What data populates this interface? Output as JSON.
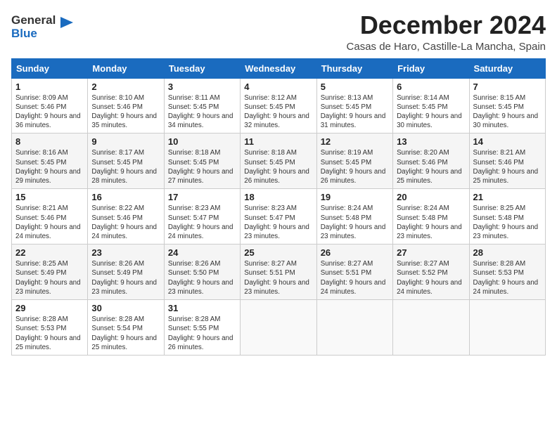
{
  "logo": {
    "general": "General",
    "blue": "Blue"
  },
  "title": "December 2024",
  "subtitle": "Casas de Haro, Castille-La Mancha, Spain",
  "headers": [
    "Sunday",
    "Monday",
    "Tuesday",
    "Wednesday",
    "Thursday",
    "Friday",
    "Saturday"
  ],
  "weeks": [
    [
      {
        "day": "1",
        "sunrise": "Sunrise: 8:09 AM",
        "sunset": "Sunset: 5:46 PM",
        "daylight": "Daylight: 9 hours and 36 minutes."
      },
      {
        "day": "2",
        "sunrise": "Sunrise: 8:10 AM",
        "sunset": "Sunset: 5:46 PM",
        "daylight": "Daylight: 9 hours and 35 minutes."
      },
      {
        "day": "3",
        "sunrise": "Sunrise: 8:11 AM",
        "sunset": "Sunset: 5:45 PM",
        "daylight": "Daylight: 9 hours and 34 minutes."
      },
      {
        "day": "4",
        "sunrise": "Sunrise: 8:12 AM",
        "sunset": "Sunset: 5:45 PM",
        "daylight": "Daylight: 9 hours and 32 minutes."
      },
      {
        "day": "5",
        "sunrise": "Sunrise: 8:13 AM",
        "sunset": "Sunset: 5:45 PM",
        "daylight": "Daylight: 9 hours and 31 minutes."
      },
      {
        "day": "6",
        "sunrise": "Sunrise: 8:14 AM",
        "sunset": "Sunset: 5:45 PM",
        "daylight": "Daylight: 9 hours and 30 minutes."
      },
      {
        "day": "7",
        "sunrise": "Sunrise: 8:15 AM",
        "sunset": "Sunset: 5:45 PM",
        "daylight": "Daylight: 9 hours and 30 minutes."
      }
    ],
    [
      {
        "day": "8",
        "sunrise": "Sunrise: 8:16 AM",
        "sunset": "Sunset: 5:45 PM",
        "daylight": "Daylight: 9 hours and 29 minutes."
      },
      {
        "day": "9",
        "sunrise": "Sunrise: 8:17 AM",
        "sunset": "Sunset: 5:45 PM",
        "daylight": "Daylight: 9 hours and 28 minutes."
      },
      {
        "day": "10",
        "sunrise": "Sunrise: 8:18 AM",
        "sunset": "Sunset: 5:45 PM",
        "daylight": "Daylight: 9 hours and 27 minutes."
      },
      {
        "day": "11",
        "sunrise": "Sunrise: 8:18 AM",
        "sunset": "Sunset: 5:45 PM",
        "daylight": "Daylight: 9 hours and 26 minutes."
      },
      {
        "day": "12",
        "sunrise": "Sunrise: 8:19 AM",
        "sunset": "Sunset: 5:45 PM",
        "daylight": "Daylight: 9 hours and 26 minutes."
      },
      {
        "day": "13",
        "sunrise": "Sunrise: 8:20 AM",
        "sunset": "Sunset: 5:46 PM",
        "daylight": "Daylight: 9 hours and 25 minutes."
      },
      {
        "day": "14",
        "sunrise": "Sunrise: 8:21 AM",
        "sunset": "Sunset: 5:46 PM",
        "daylight": "Daylight: 9 hours and 25 minutes."
      }
    ],
    [
      {
        "day": "15",
        "sunrise": "Sunrise: 8:21 AM",
        "sunset": "Sunset: 5:46 PM",
        "daylight": "Daylight: 9 hours and 24 minutes."
      },
      {
        "day": "16",
        "sunrise": "Sunrise: 8:22 AM",
        "sunset": "Sunset: 5:46 PM",
        "daylight": "Daylight: 9 hours and 24 minutes."
      },
      {
        "day": "17",
        "sunrise": "Sunrise: 8:23 AM",
        "sunset": "Sunset: 5:47 PM",
        "daylight": "Daylight: 9 hours and 24 minutes."
      },
      {
        "day": "18",
        "sunrise": "Sunrise: 8:23 AM",
        "sunset": "Sunset: 5:47 PM",
        "daylight": "Daylight: 9 hours and 23 minutes."
      },
      {
        "day": "19",
        "sunrise": "Sunrise: 8:24 AM",
        "sunset": "Sunset: 5:48 PM",
        "daylight": "Daylight: 9 hours and 23 minutes."
      },
      {
        "day": "20",
        "sunrise": "Sunrise: 8:24 AM",
        "sunset": "Sunset: 5:48 PM",
        "daylight": "Daylight: 9 hours and 23 minutes."
      },
      {
        "day": "21",
        "sunrise": "Sunrise: 8:25 AM",
        "sunset": "Sunset: 5:48 PM",
        "daylight": "Daylight: 9 hours and 23 minutes."
      }
    ],
    [
      {
        "day": "22",
        "sunrise": "Sunrise: 8:25 AM",
        "sunset": "Sunset: 5:49 PM",
        "daylight": "Daylight: 9 hours and 23 minutes."
      },
      {
        "day": "23",
        "sunrise": "Sunrise: 8:26 AM",
        "sunset": "Sunset: 5:49 PM",
        "daylight": "Daylight: 9 hours and 23 minutes."
      },
      {
        "day": "24",
        "sunrise": "Sunrise: 8:26 AM",
        "sunset": "Sunset: 5:50 PM",
        "daylight": "Daylight: 9 hours and 23 minutes."
      },
      {
        "day": "25",
        "sunrise": "Sunrise: 8:27 AM",
        "sunset": "Sunset: 5:51 PM",
        "daylight": "Daylight: 9 hours and 23 minutes."
      },
      {
        "day": "26",
        "sunrise": "Sunrise: 8:27 AM",
        "sunset": "Sunset: 5:51 PM",
        "daylight": "Daylight: 9 hours and 24 minutes."
      },
      {
        "day": "27",
        "sunrise": "Sunrise: 8:27 AM",
        "sunset": "Sunset: 5:52 PM",
        "daylight": "Daylight: 9 hours and 24 minutes."
      },
      {
        "day": "28",
        "sunrise": "Sunrise: 8:28 AM",
        "sunset": "Sunset: 5:53 PM",
        "daylight": "Daylight: 9 hours and 24 minutes."
      }
    ],
    [
      {
        "day": "29",
        "sunrise": "Sunrise: 8:28 AM",
        "sunset": "Sunset: 5:53 PM",
        "daylight": "Daylight: 9 hours and 25 minutes."
      },
      {
        "day": "30",
        "sunrise": "Sunrise: 8:28 AM",
        "sunset": "Sunset: 5:54 PM",
        "daylight": "Daylight: 9 hours and 25 minutes."
      },
      {
        "day": "31",
        "sunrise": "Sunrise: 8:28 AM",
        "sunset": "Sunset: 5:55 PM",
        "daylight": "Daylight: 9 hours and 26 minutes."
      },
      null,
      null,
      null,
      null
    ]
  ]
}
